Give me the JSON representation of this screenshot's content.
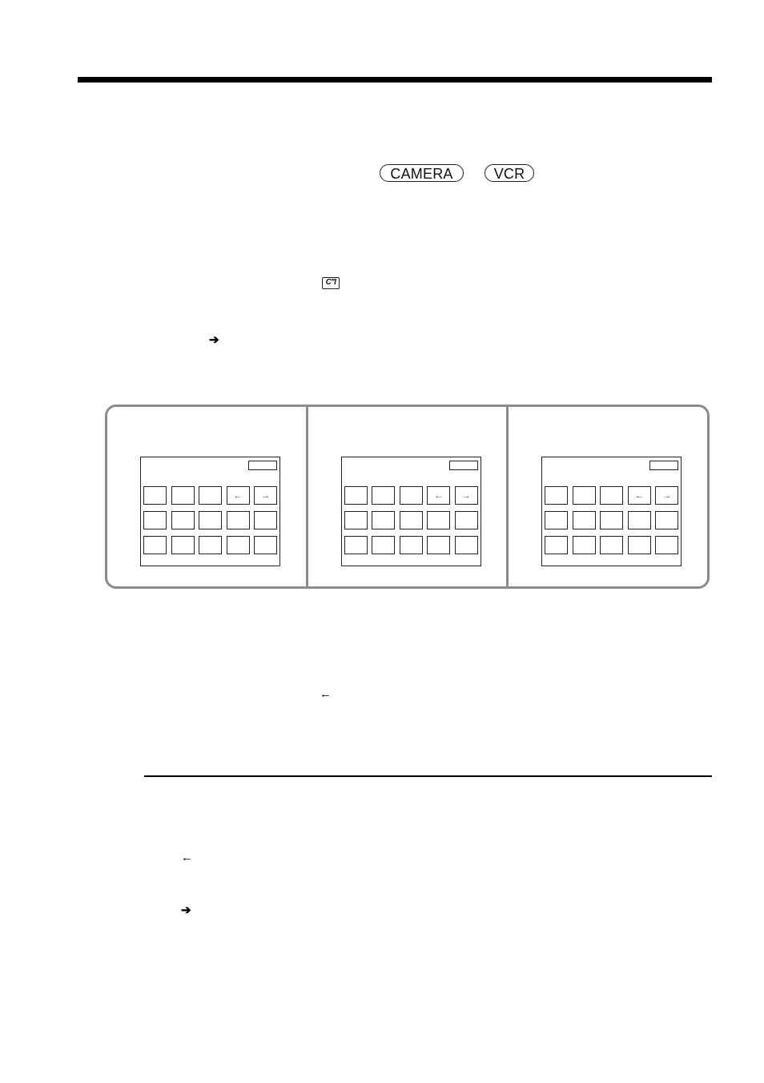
{
  "header": {
    "mode_badges": [
      "CAMERA",
      "VCR"
    ]
  },
  "icons": {
    "tele_macro_label": "C′′I",
    "arrow_right": "➔",
    "arrow_left": "←"
  },
  "illustration": {
    "panels": [
      {
        "screen_buttons": [
          "",
          "",
          "",
          "←",
          "→",
          "",
          "",
          "",
          "",
          "",
          "",
          "",
          "",
          "",
          ""
        ]
      },
      {
        "screen_buttons": [
          "",
          "",
          "",
          "←",
          "→",
          "",
          "",
          "",
          "",
          "",
          "",
          "",
          "",
          "",
          ""
        ]
      },
      {
        "screen_buttons": [
          "",
          "",
          "",
          "←",
          "→",
          "",
          "",
          "",
          "",
          "",
          "",
          "",
          "",
          "",
          ""
        ]
      }
    ]
  },
  "colors": {
    "panel_border": "#8a8b8f",
    "rule": "#000000"
  }
}
